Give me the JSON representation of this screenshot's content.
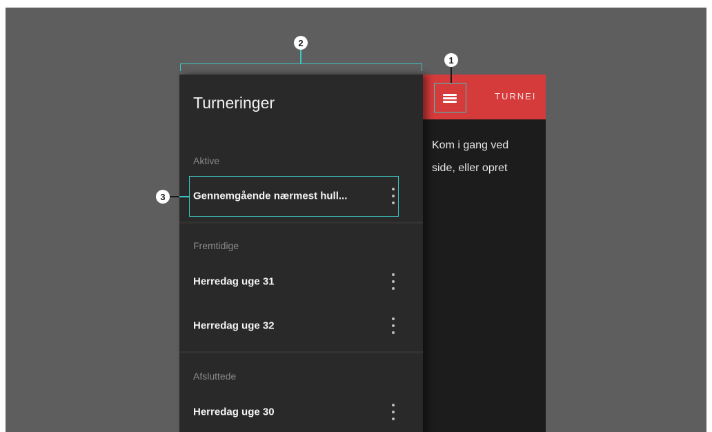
{
  "toolbar": {
    "menu_icon": "hamburger-menu-icon",
    "title": "TURNEI",
    "color": "#d63b3b"
  },
  "main": {
    "text_line1": "Kom i gang ved",
    "text_line2": "side, eller opret"
  },
  "drawer": {
    "title": "Turneringer",
    "sections": [
      {
        "label": "Aktive",
        "items": [
          {
            "label": "Gennemgående nærmest hull...",
            "menu_icon": "more-vert-icon"
          }
        ]
      },
      {
        "label": "Fremtidige",
        "items": [
          {
            "label": "Herredag uge 31",
            "menu_icon": "more-vert-icon"
          },
          {
            "label": "Herredag uge 32",
            "menu_icon": "more-vert-icon"
          }
        ]
      },
      {
        "label": "Afsluttede",
        "items": [
          {
            "label": "Herredag uge 30",
            "menu_icon": "more-vert-icon"
          }
        ]
      }
    ]
  },
  "annotations": {
    "callout_1": "1",
    "callout_2": "2",
    "callout_3": "3",
    "highlight_color": "#3cc7c3"
  }
}
